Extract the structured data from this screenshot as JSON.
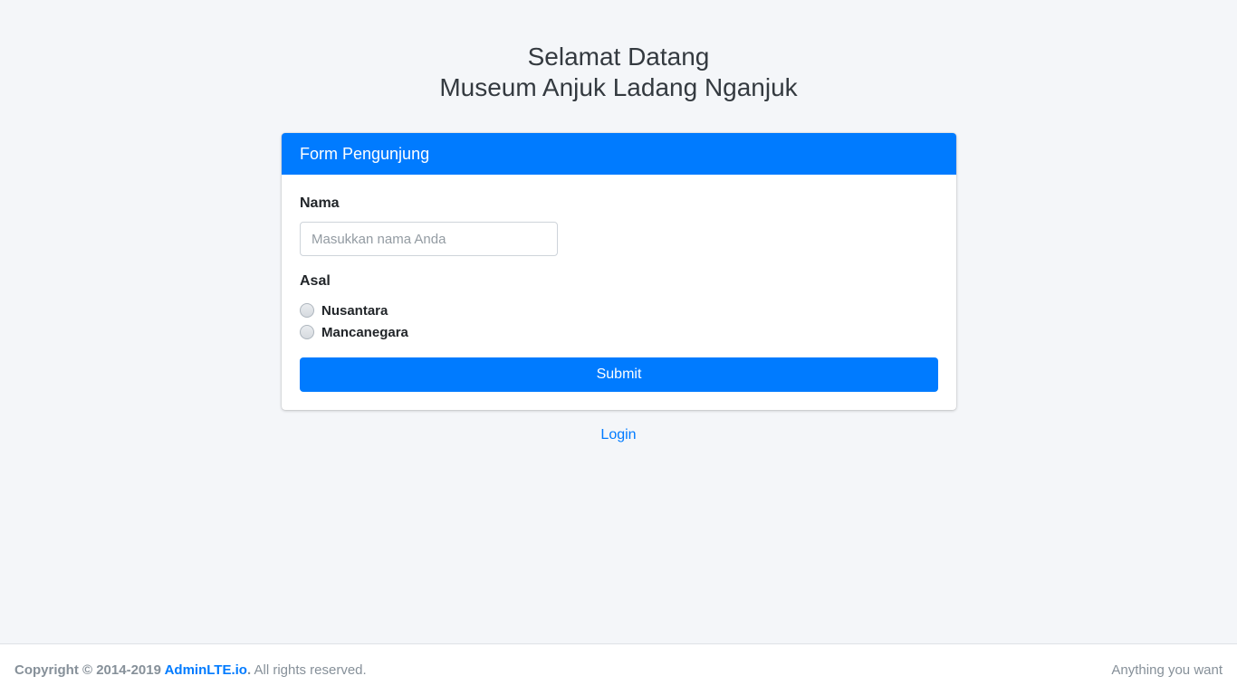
{
  "header": {
    "line1": "Selamat Datang",
    "line2": "Museum Anjuk Ladang Nganjuk"
  },
  "form": {
    "title": "Form Pengunjung",
    "nama_label": "Nama",
    "nama_placeholder": "Masukkan nama Anda",
    "nama_value": "",
    "asal_label": "Asal",
    "asal_options": [
      "Nusantara",
      "Mancanegara"
    ],
    "submit_label": "Submit"
  },
  "login_link": "Login",
  "footer": {
    "copyright_prefix": "Copyright © 2014-2019",
    "brand_link": "AdminLTE.io",
    "period": ".",
    "rights": " All rights reserved.",
    "right_text": "Anything you want"
  },
  "colors": {
    "primary": "#007bff",
    "background": "#f4f6f9"
  }
}
